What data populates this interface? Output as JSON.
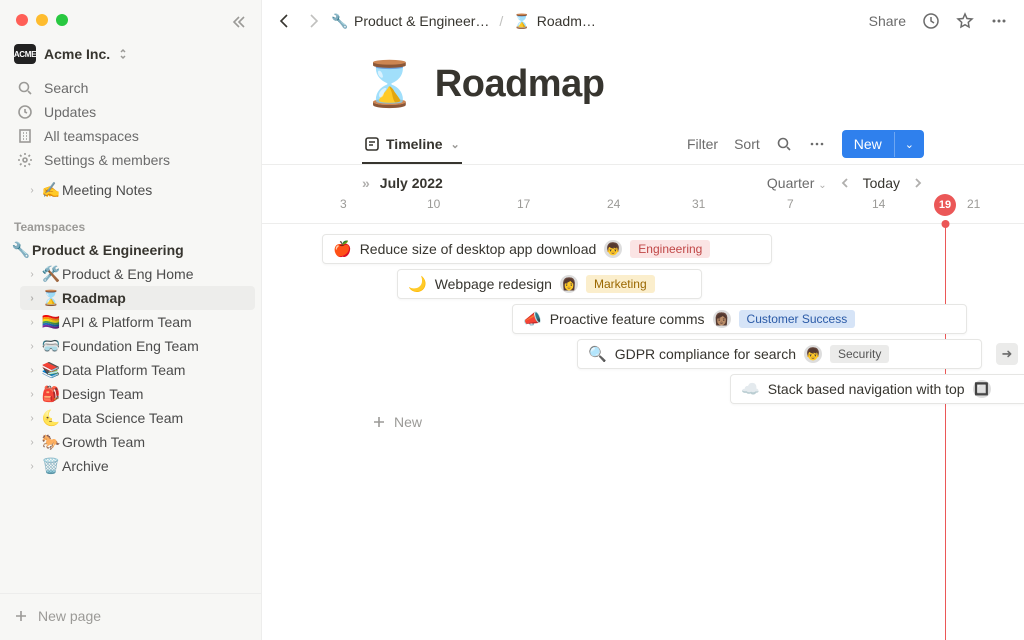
{
  "workspace": {
    "badge": "ACME",
    "name": "Acme Inc."
  },
  "nav": {
    "search": "Search",
    "updates": "Updates",
    "teamspaces": "All teamspaces",
    "settings": "Settings & members"
  },
  "quick": {
    "emoji": "✍️",
    "label": "Meeting Notes"
  },
  "teamspaces_label": "Teamspaces",
  "ts": {
    "emoji": "🔧",
    "name": "Product & Engineering",
    "children": [
      {
        "emoji": "🛠️",
        "label": "Product & Eng Home"
      },
      {
        "emoji": "⌛",
        "label": "Roadmap"
      },
      {
        "emoji": "🏳️‍🌈",
        "label": "API & Platform Team"
      },
      {
        "emoji": "🥽",
        "label": "Foundation Eng Team"
      },
      {
        "emoji": "📚",
        "label": "Data Platform Team"
      },
      {
        "emoji": "🎒",
        "label": "Design Team"
      },
      {
        "emoji": "🌜",
        "label": "Data Science Team"
      },
      {
        "emoji": "🐎",
        "label": "Growth Team"
      },
      {
        "emoji": "🗑️",
        "label": "Archive"
      }
    ]
  },
  "new_page": "New page",
  "breadcrumb": {
    "p1_emoji": "🔧",
    "p1": "Product & Engineer…",
    "p2_emoji": "⌛",
    "p2": "Roadm…"
  },
  "topbar": {
    "share": "Share"
  },
  "page": {
    "emoji": "⌛",
    "title": "Roadmap"
  },
  "view": {
    "tab": "Timeline",
    "filter": "Filter",
    "sort": "Sort",
    "new": "New"
  },
  "timeline": {
    "month": "July 2022",
    "zoom": "Quarter",
    "today": "Today",
    "today_num": "19",
    "dates": [
      "3",
      "10",
      "17",
      "24",
      "31",
      "7",
      "14",
      "21"
    ]
  },
  "bars": [
    {
      "emoji": "🍎",
      "title": "Reduce size of desktop app download",
      "avatar": "👦",
      "tag": "Engineering",
      "tagClass": "eng"
    },
    {
      "emoji": "🌙",
      "title": "Webpage redesign",
      "avatar": "👩",
      "tag": "Marketing",
      "tagClass": "mkt"
    },
    {
      "emoji": "📣",
      "title": "Proactive feature comms",
      "avatar": "👩🏽",
      "tag": "Customer Success",
      "tagClass": "cs"
    },
    {
      "emoji": "🔍",
      "title": "GDPR compliance for search",
      "avatar": "👦",
      "tag": "Security",
      "tagClass": "sec"
    },
    {
      "emoji": "☁️",
      "title": "Stack based navigation with top",
      "avatar": "🔲",
      "tag": "",
      "tagClass": ""
    }
  ],
  "new_row": "New"
}
